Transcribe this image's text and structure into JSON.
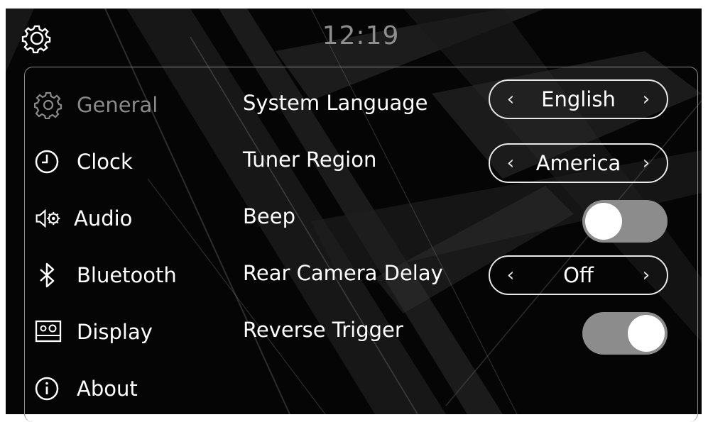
{
  "header": {
    "time": "12:19",
    "settings_icon": "gear-icon"
  },
  "sidebar": {
    "items": [
      {
        "label": "General",
        "icon": "gear-icon",
        "active": true
      },
      {
        "label": "Clock",
        "icon": "clock-icon",
        "active": false
      },
      {
        "label": "Audio",
        "icon": "speaker-gear-icon",
        "active": false
      },
      {
        "label": "Bluetooth",
        "icon": "bluetooth-icon",
        "active": false
      },
      {
        "label": "Display",
        "icon": "display-icon",
        "active": false
      },
      {
        "label": "About",
        "icon": "info-icon",
        "active": false
      }
    ]
  },
  "settings": {
    "system_language": {
      "label": "System Language",
      "value": "English"
    },
    "tuner_region": {
      "label": "Tuner Region",
      "value": "America"
    },
    "beep": {
      "label": "Beep",
      "state": "off"
    },
    "rear_camera_delay": {
      "label": "Rear Camera Delay",
      "value": "Off"
    },
    "reverse_trigger": {
      "label": "Reverse Trigger",
      "state": "on"
    }
  },
  "selector_arrows": {
    "prev": "‹",
    "next": "›"
  },
  "colors": {
    "background": "#050505",
    "active_text": "#8a8a8a",
    "text": "#ffffff",
    "toggle_track": "#8c8c8c",
    "clock_text": "#8f8f8f"
  }
}
